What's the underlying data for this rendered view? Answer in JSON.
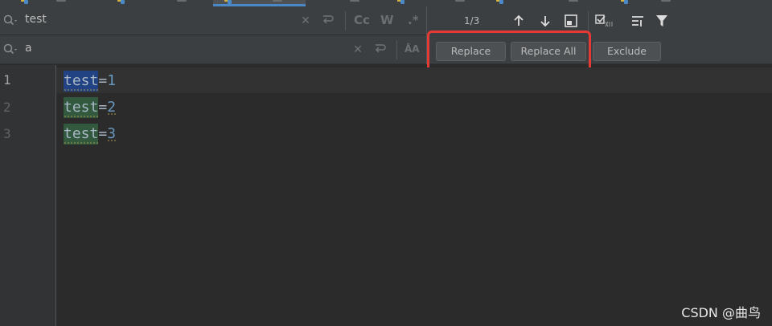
{
  "find": {
    "search_value": "test",
    "replace_value": "a",
    "match_counter": "1/3",
    "options": {
      "match_case": "Cc",
      "words": "W",
      "regex": ".*",
      "preserve_case": "ÅA"
    }
  },
  "buttons": {
    "replace": "Replace",
    "replace_all": "Replace All",
    "exclude": "Exclude"
  },
  "editor": {
    "lines": [
      {
        "number": "1",
        "word": "test",
        "eq": "=",
        "value": "1"
      },
      {
        "number": "2",
        "word": "test",
        "eq": "=",
        "value": "2"
      },
      {
        "number": "3",
        "word": "test",
        "eq": "=",
        "value": "3"
      }
    ]
  },
  "watermark": "CSDN @曲鸟",
  "colors": {
    "background": "#2b2b2b",
    "panel": "#3c3f41",
    "current_match": "#214283",
    "other_match": "#32593d",
    "annotation_box": "#e53935",
    "number": "#6897bb",
    "tab_underline": "#4a88c7"
  },
  "icons": [
    "search-icon",
    "clear-icon",
    "newline-icon",
    "prev-occurrence-icon",
    "next-occurrence-icon",
    "select-all-occurrences-icon",
    "filter-icon"
  ]
}
